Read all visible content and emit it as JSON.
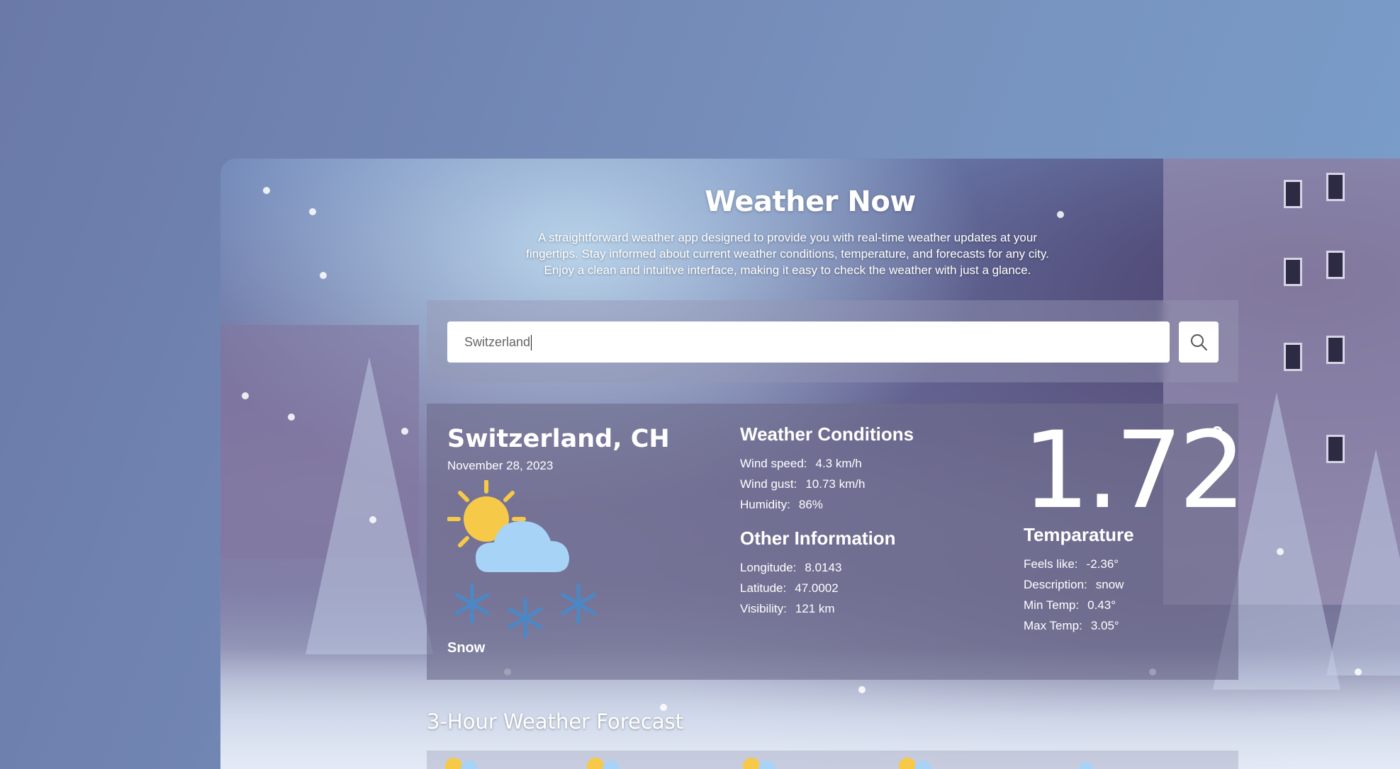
{
  "app": {
    "title": "Weather Now",
    "description": "A straightforward weather app designed to provide you with real-time weather updates at your fingertips. Stay informed about current weather conditions, temperature, and forecasts for any city. Enjoy a clean and intuitive interface, making it easy to check the weather with just a glance."
  },
  "search": {
    "value": "Switzerland",
    "button_icon": "search-icon"
  },
  "current": {
    "city": "Switzerland, CH",
    "date": "November 28, 2023",
    "icon": "sun-cloud-snow-icon",
    "condition": "Snow"
  },
  "weather_conditions": {
    "title": "Weather Conditions",
    "rows": [
      {
        "label": "Wind speed:",
        "value": "4.3 km/h"
      },
      {
        "label": "Wind gust:",
        "value": "10.73 km/h"
      },
      {
        "label": "Humidity:",
        "value": "86%"
      }
    ]
  },
  "other_information": {
    "title": "Other Information",
    "rows": [
      {
        "label": "Longitude:",
        "value": "8.0143"
      },
      {
        "label": "Latitude:",
        "value": "47.0002"
      },
      {
        "label": "Visibility:",
        "value": "121 km"
      }
    ]
  },
  "temperature": {
    "value": "1.72",
    "degree_symbol": "°",
    "title": "Temparature",
    "rows": [
      {
        "label": "Feels like:",
        "value": "-2.36°"
      },
      {
        "label": "Description:",
        "value": "snow"
      },
      {
        "label": "Min Temp:",
        "value": "0.43°"
      },
      {
        "label": "Max Temp:",
        "value": "3.05°"
      }
    ]
  },
  "forecast": {
    "title": "3-Hour Weather Forecast"
  },
  "colors": {
    "page_background": "#7088b6",
    "panel_overlay": "#6e6c8c",
    "text": "#ffffff",
    "sun": "#f7c948",
    "cloud": "#a7d3f7",
    "snowflake": "#4a88c7"
  }
}
